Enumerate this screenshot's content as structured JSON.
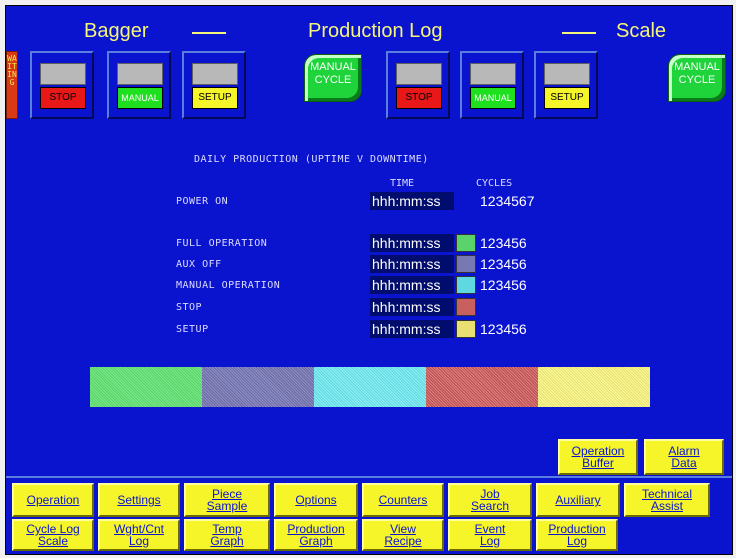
{
  "header": {
    "left_title": "Bagger",
    "center_title": "Production Log",
    "right_title": "Scale"
  },
  "status": {
    "waiting": "WAITING"
  },
  "bagger_controls": {
    "stop_label": "STOP",
    "manual_label": "MANUAL",
    "setup_label": "SETUP",
    "manual_cycle_line1": "MANUAL",
    "manual_cycle_line2": "CYCLE"
  },
  "scale_controls": {
    "stop_label": "STOP",
    "manual_label": "MANUAL",
    "setup_label": "SETUP",
    "manual_cycle_line1": "MANUAL",
    "manual_cycle_line2": "CYCLE"
  },
  "production": {
    "title": "DAILY PRODUCTION (UPTIME V DOWNTIME)",
    "col_time": "TIME",
    "col_cycles": "CYCLES",
    "power_on": {
      "label": "POWER ON",
      "time": "hhh:mm:ss",
      "cycles": "1234567"
    },
    "rows": [
      {
        "label": "FULL OPERATION",
        "time": "hhh:mm:ss",
        "cycles": "123456",
        "color": "#5ad46a"
      },
      {
        "label": "AUX OFF",
        "time": "hhh:mm:ss",
        "cycles": "123456",
        "color": "#7878b4"
      },
      {
        "label": "MANUAL OPERATION",
        "time": "hhh:mm:ss",
        "cycles": "123456",
        "color": "#60d8e0"
      },
      {
        "label": "STOP",
        "time": "hhh:mm:ss",
        "cycles": "",
        "color": "#c86060"
      },
      {
        "label": "SETUP",
        "time": "hhh:mm:ss",
        "cycles": "123456",
        "color": "#e8e070"
      }
    ]
  },
  "uptime_bar": {
    "segments": [
      {
        "name": "full-operation",
        "fraction": 0.2
      },
      {
        "name": "aux-off",
        "fraction": 0.2
      },
      {
        "name": "manual-operation",
        "fraction": 0.2
      },
      {
        "name": "stop",
        "fraction": 0.2
      },
      {
        "name": "setup",
        "fraction": 0.2
      }
    ]
  },
  "side_buttons": {
    "operation_buffer": [
      "Operation",
      "Buffer"
    ],
    "alarm_data": [
      "Alarm",
      "Data"
    ]
  },
  "nav_row1": [
    [
      "Operation"
    ],
    [
      "Settings"
    ],
    [
      "Piece",
      "Sample"
    ],
    [
      "Options"
    ],
    [
      "Counters"
    ],
    [
      "Job",
      "Search"
    ],
    [
      "Auxiliary"
    ],
    [
      "Technical",
      "Assist"
    ]
  ],
  "nav_row2": [
    [
      "Cycle Log",
      "Scale"
    ],
    [
      "Wght/Cnt",
      "Log"
    ],
    [
      "Temp",
      "Graph"
    ],
    [
      "Production",
      "Graph"
    ],
    [
      "View",
      "Recipe"
    ],
    [
      "Event",
      "Log"
    ],
    [
      "Production",
      "Log"
    ]
  ]
}
